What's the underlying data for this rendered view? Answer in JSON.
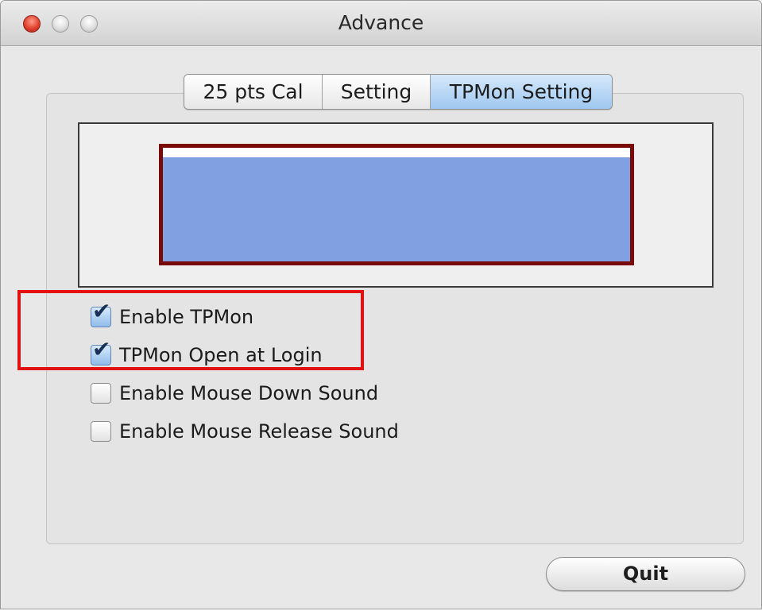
{
  "window": {
    "title": "Advance"
  },
  "tabs": [
    {
      "label": "25 pts Cal",
      "selected": false
    },
    {
      "label": "Setting",
      "selected": false
    },
    {
      "label": "TPMon Setting",
      "selected": true
    }
  ],
  "options": [
    {
      "label": "Enable TPMon",
      "checked": true
    },
    {
      "label": "TPMon Open at Login",
      "checked": true
    },
    {
      "label": "Enable Mouse Down Sound",
      "checked": false
    },
    {
      "label": "Enable Mouse Release Sound",
      "checked": false
    }
  ],
  "buttons": {
    "quit_label": "Quit"
  },
  "icons": {
    "close": "close-icon",
    "minimize": "minimize-icon",
    "zoom": "zoom-icon",
    "check": "checkmark-icon"
  },
  "colors": {
    "preview_fill": "#81a0e2",
    "preview_border": "#7a0a0a",
    "highlight": "#e31212",
    "selected_tab": "#9fc7f0"
  }
}
